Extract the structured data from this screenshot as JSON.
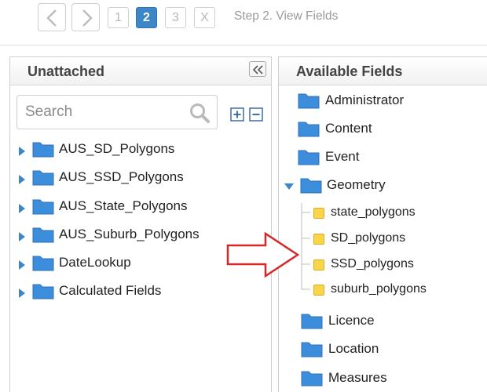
{
  "wizard": {
    "steps": [
      "1",
      "2",
      "3"
    ],
    "active_step": "2",
    "close_label": "X",
    "title": "Step 2. View Fields"
  },
  "left_panel": {
    "title": "Unattached",
    "search": {
      "placeholder": "Search",
      "value": ""
    },
    "items": [
      {
        "label": "AUS_SD_Polygons"
      },
      {
        "label": "AUS_SSD_Polygons"
      },
      {
        "label": "AUS_State_Polygons"
      },
      {
        "label": "AUS_Suburb_Polygons"
      },
      {
        "label": "DateLookup"
      },
      {
        "label": "Calculated Fields"
      }
    ]
  },
  "right_panel": {
    "title": "Available Fields",
    "items": [
      {
        "label": "Administrator"
      },
      {
        "label": "Content"
      },
      {
        "label": "Event"
      },
      {
        "label": "Geometry",
        "expanded": true,
        "children": [
          {
            "label": "state_polygons"
          },
          {
            "label": "SD_polygons"
          },
          {
            "label": "SSD_polygons"
          },
          {
            "label": "suburb_polygons"
          }
        ]
      },
      {
        "label": "Licence"
      },
      {
        "label": "Location"
      },
      {
        "label": "Measures"
      }
    ]
  },
  "colors": {
    "accent": "#3d87c8",
    "folder": "#3c8ddc",
    "leaf": "#fbd548",
    "arrow": "#d62828"
  }
}
